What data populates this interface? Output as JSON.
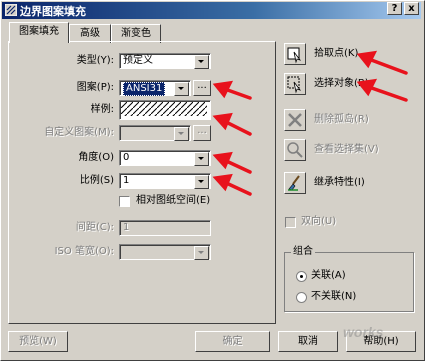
{
  "window": {
    "title": "边界图案填充",
    "help_label": "?",
    "close_label": "x"
  },
  "tabs": [
    {
      "label": "图案填充",
      "active": true
    },
    {
      "label": "高级",
      "active": false
    },
    {
      "label": "渐变色",
      "active": false
    }
  ],
  "fields": {
    "type": {
      "label": "类型(Y):",
      "value": "预定义"
    },
    "pattern": {
      "label": "图案(P):",
      "value": "ANSI31",
      "browse": "..."
    },
    "swatch": {
      "label": "样例:"
    },
    "custom_pattern": {
      "label": "自定义图案(M):",
      "value": "",
      "browse": "..."
    },
    "angle": {
      "label": "角度(O)",
      "value": "0"
    },
    "scale": {
      "label": "比例(S)",
      "value": "1"
    },
    "relative_paperspace": {
      "label": "相对图纸空间(E)",
      "checked": false
    },
    "spacing": {
      "label": "间距(C):",
      "value": "1"
    },
    "iso_pen_width": {
      "label": "ISO 笔宽(O):",
      "value": ""
    }
  },
  "actions": [
    {
      "label": "拾取点(K)",
      "icon": "pick-point-icon",
      "enabled": true
    },
    {
      "label": "选择对象(B)",
      "icon": "select-objects-icon",
      "enabled": true
    },
    {
      "label": "删除孤岛(R)",
      "icon": "delete-x-icon",
      "enabled": false
    },
    {
      "label": "查看选择集(V)",
      "icon": "magnifier-icon",
      "enabled": false
    },
    {
      "label": "继承特性(I)",
      "icon": "brush-icon",
      "enabled": true
    }
  ],
  "double": {
    "label": "双向(U)",
    "checked": false
  },
  "composition": {
    "title": "组合",
    "options": [
      {
        "label": "关联(A)",
        "selected": true
      },
      {
        "label": "不关联(N)",
        "selected": false
      }
    ]
  },
  "footer": {
    "preview": "预览(W)",
    "ok": "确定",
    "cancel": "取消",
    "help": "帮助(H)"
  },
  "watermark": "works",
  "colors": {
    "dialog_bg": "#d4d0c8",
    "title_start": "#0a246a",
    "arrow": "#e8121c"
  }
}
